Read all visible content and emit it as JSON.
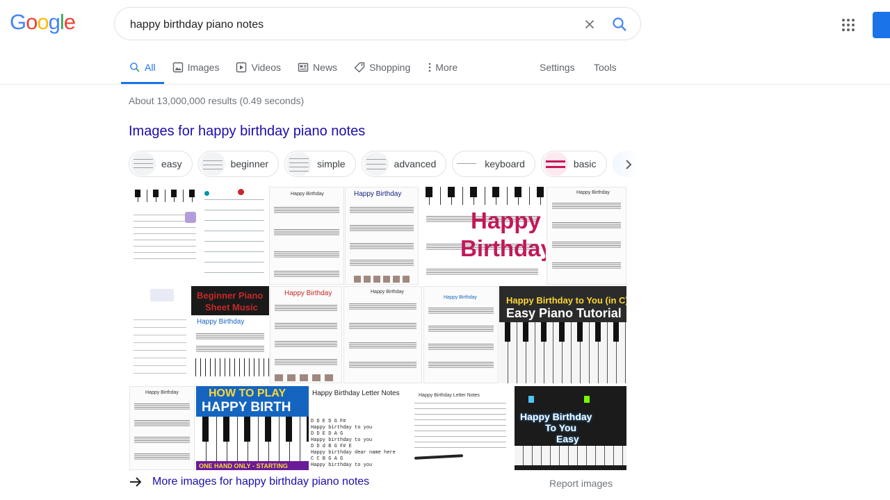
{
  "logo": {
    "letters": [
      "G",
      "o",
      "o",
      "g",
      "l",
      "e"
    ],
    "colors": [
      "#4285f4",
      "#ea4335",
      "#fbbc05",
      "#4285f4",
      "#34a853",
      "#ea4335"
    ]
  },
  "search": {
    "query": "happy birthday piano notes"
  },
  "tabs": [
    {
      "label": "All",
      "icon": "search-icon",
      "active": true
    },
    {
      "label": "Images",
      "icon": "image-icon"
    },
    {
      "label": "Videos",
      "icon": "video-icon"
    },
    {
      "label": "News",
      "icon": "news-icon"
    },
    {
      "label": "Shopping",
      "icon": "tag-icon"
    },
    {
      "label": "More",
      "icon": "dots-vertical-icon"
    }
  ],
  "settings_label": "Settings",
  "tools_label": "Tools",
  "stats": "About 13,000,000 results (0.49 seconds)",
  "images_title": "Images for happy birthday piano notes",
  "chips": [
    "easy",
    "beginner",
    "simple",
    "advanced",
    "keyboard",
    "basic"
  ],
  "image_texts": {
    "hb": "Happy Birthday",
    "happy": "Happy",
    "birthday": "Birthday",
    "beginner_piano": "Beginner Piano",
    "sheet_music": "Sheet Music",
    "hb_to_you_c": "Happy Birthday to You (in C)",
    "easy_tutorial": "Easy Piano Tutorial",
    "how_to_play": "HOW TO PLAY",
    "happy_birth": "HAPPY BIRTH",
    "one_hand": "ONE HAND ONLY - STARTING",
    "letter_notes": "Happy Birthday Letter Notes",
    "letter_notes_sm": "Happy Birthday Letter Notes",
    "hb_line1": "Happy Birthday",
    "hb_line2": "To You",
    "hb_line3": "Easy",
    "note_lines": [
      "D D E D G F#",
      "Happy birthday to you",
      "D D E D A G",
      "Happy birthday to you",
      "D D d B G F# E",
      "Happy birthday dear name here",
      "C C B G A G",
      "Happy birthday to you"
    ]
  },
  "more_images": "More images for happy birthday piano notes",
  "report_images": "Report images"
}
